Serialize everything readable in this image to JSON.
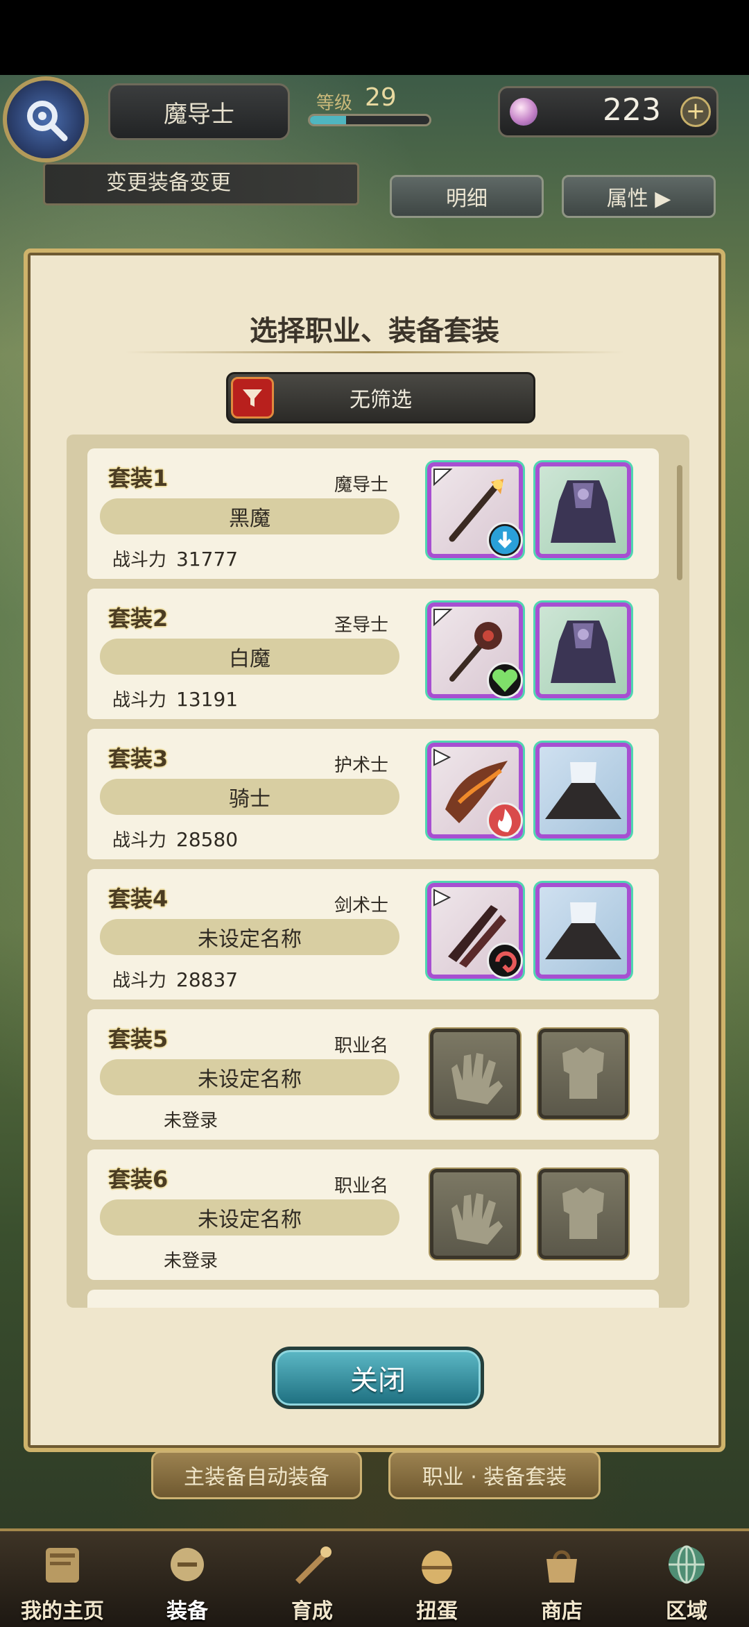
{
  "header": {
    "job_name": "魔导士",
    "level_label": "等级",
    "level": "29",
    "level_progress": 0.3,
    "gem_count": "223",
    "gem_plus": "+",
    "change_label": "变更装备变更",
    "detail_button": "明细",
    "attr_button": "属性 ▶"
  },
  "panel": {
    "title": "选择职业、装备套装",
    "filter_label": "无筛选",
    "power_label": "战斗力",
    "sets": [
      {
        "label": "套装1",
        "job": "魔导士",
        "name": "黑魔",
        "power": "31777",
        "registered": true,
        "badge": "download"
      },
      {
        "label": "套装2",
        "job": "圣导士",
        "name": "白魔",
        "power": "13191",
        "registered": true,
        "badge": "heart"
      },
      {
        "label": "套装3",
        "job": "护术士",
        "name": "骑士",
        "power": "28580",
        "registered": true,
        "badge": "flame"
      },
      {
        "label": "套装4",
        "job": "剑术士",
        "name": "未设定名称",
        "power": "28837",
        "registered": true,
        "badge": "swirl"
      },
      {
        "label": "套装5",
        "job": "职业名",
        "name": "未设定名称",
        "unregistered": "未登录",
        "registered": false
      },
      {
        "label": "套装6",
        "job": "职业名",
        "name": "未设定名称",
        "unregistered": "未登录",
        "registered": false
      }
    ],
    "close_button": "关闭"
  },
  "actions": {
    "auto_equip": "主装备自动装备",
    "job_sets": "职业 · 装备套装"
  },
  "nav": [
    {
      "label": "我的主页",
      "icon": "home-scroll-icon"
    },
    {
      "label": "装备",
      "icon": "equipment-icon"
    },
    {
      "label": "育成",
      "icon": "training-icon"
    },
    {
      "label": "扭蛋",
      "icon": "gacha-icon"
    },
    {
      "label": "商店",
      "icon": "shop-icon"
    },
    {
      "label": "区域",
      "icon": "globe-icon"
    }
  ],
  "colors": {
    "accent": "#cfb36b",
    "panel_bg": "#efe6cc",
    "close_button": "#3ea5b4",
    "filter_red": "#b8201d"
  }
}
